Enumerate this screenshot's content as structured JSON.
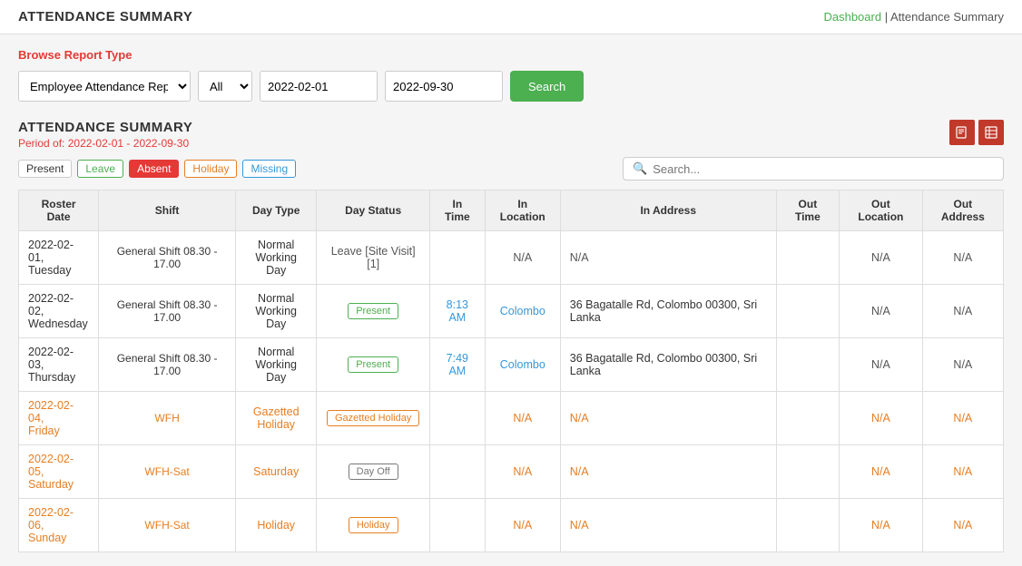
{
  "topBar": {
    "title": "ATTENDANCE SUMMARY",
    "breadcrumb": {
      "dashboard": "Dashboard",
      "separator": " | ",
      "current": "Attendance Summary"
    }
  },
  "filter": {
    "browseLabel": "Browse Report Type",
    "reportType": "Employee Attendance Report",
    "allOption": "All",
    "dateFrom": "2022-02-01",
    "dateTo": "2022-09-30",
    "searchButton": "Search"
  },
  "section": {
    "title": "ATTENDANCE SUMMARY",
    "periodLabel": "Period of:",
    "period": "2022-02-01 - 2022-09-30"
  },
  "legend": {
    "present": "Present",
    "leave": "Leave",
    "absent": "Absent",
    "holiday": "Holiday",
    "missing": "Missing"
  },
  "search": {
    "placeholder": "Search..."
  },
  "export": {
    "pdf": "PDF",
    "excel": "XLS"
  },
  "table": {
    "headers": [
      "Roster Date",
      "Shift",
      "Day Type",
      "Day Status",
      "In Time",
      "In Location",
      "In Address",
      "Out Time",
      "Out Location",
      "Out Address"
    ],
    "rows": [
      {
        "rosterDate": "2022-02-01,\nTuesday",
        "shift": "General Shift 08.30 - 17.00",
        "dayType": "Normal\nWorking Day",
        "dayStatus": "Leave [Site Visit] [1]",
        "dayStatusType": "leave",
        "inTime": "",
        "inLocation": "N/A",
        "inAddress": "N/A",
        "outTime": "",
        "outLocation": "N/A",
        "outAddress": "N/A",
        "rowType": "normal"
      },
      {
        "rosterDate": "2022-02-02,\nWednesday",
        "shift": "General Shift 08.30 - 17.00",
        "dayType": "Normal\nWorking Day",
        "dayStatus": "Present",
        "dayStatusType": "present",
        "inTime": "8:13\nAM",
        "inLocation": "Colombo",
        "inAddress": "36 Bagatalle Rd, Colombo 00300, Sri Lanka",
        "outTime": "",
        "outLocation": "N/A",
        "outAddress": "N/A",
        "rowType": "normal"
      },
      {
        "rosterDate": "2022-02-03,\nThursday",
        "shift": "General Shift 08.30 - 17.00",
        "dayType": "Normal\nWorking Day",
        "dayStatus": "Present",
        "dayStatusType": "present",
        "inTime": "7:49\nAM",
        "inLocation": "Colombo",
        "inAddress": "36 Bagatalle Rd, Colombo 00300, Sri Lanka",
        "outTime": "",
        "outLocation": "N/A",
        "outAddress": "N/A",
        "rowType": "normal"
      },
      {
        "rosterDate": "2022-02-04,\nFriday",
        "shift": "WFH",
        "dayType": "Gazetted\nHoliday",
        "dayStatus": "Gazetted Holiday",
        "dayStatusType": "gazetted",
        "inTime": "",
        "inLocation": "N/A",
        "inAddress": "N/A",
        "outTime": "",
        "outLocation": "N/A",
        "outAddress": "N/A",
        "rowType": "holiday"
      },
      {
        "rosterDate": "2022-02-05,\nSaturday",
        "shift": "WFH-Sat",
        "dayType": "Saturday",
        "dayStatus": "Day Off",
        "dayStatusType": "dayoff",
        "inTime": "",
        "inLocation": "N/A",
        "inAddress": "N/A",
        "outTime": "",
        "outLocation": "N/A",
        "outAddress": "N/A",
        "rowType": "holiday"
      },
      {
        "rosterDate": "2022-02-06,\nSunday",
        "shift": "WFH-Sat",
        "dayType": "Holiday",
        "dayStatus": "Holiday",
        "dayStatusType": "holiday-badge",
        "inTime": "",
        "inLocation": "N/A",
        "inAddress": "N/A",
        "outTime": "",
        "outLocation": "N/A",
        "outAddress": "N/A",
        "rowType": "holiday"
      }
    ]
  }
}
